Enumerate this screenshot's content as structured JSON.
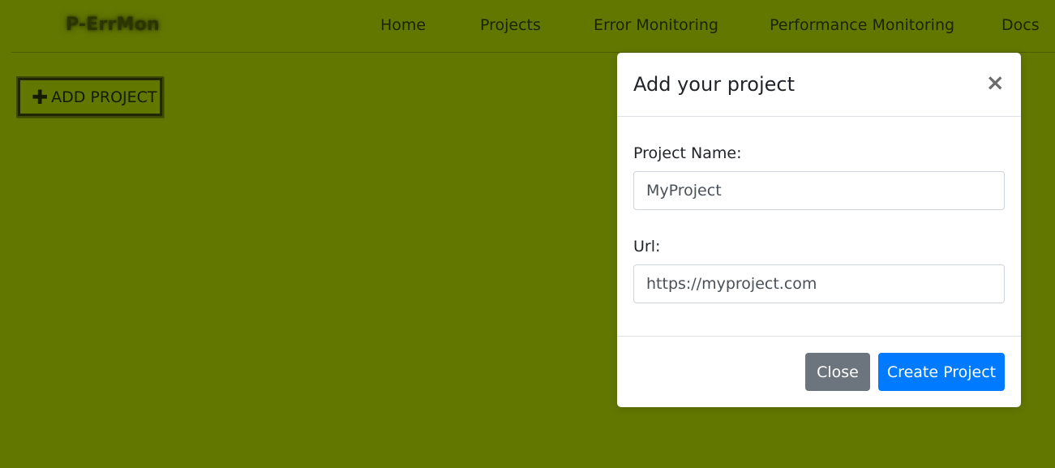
{
  "navbar": {
    "brand": "P-ErrMon",
    "links": [
      "Home",
      "Projects",
      "Error Monitoring",
      "Performance Monitoring",
      "Docs"
    ]
  },
  "main": {
    "add_project_label": "ADD PROJECT",
    "add_project_icon": "plus-icon"
  },
  "modal": {
    "title": "Add your project",
    "close_icon": "close-icon",
    "fields": [
      {
        "label": "Project Name:",
        "value": "MyProject"
      },
      {
        "label": "Url:",
        "value": "https://myproject.com"
      }
    ],
    "close_button": "Close",
    "create_button": "Create Project"
  },
  "colors": {
    "background": "#627700",
    "primary": "#007bff",
    "secondary": "#6c757d"
  }
}
